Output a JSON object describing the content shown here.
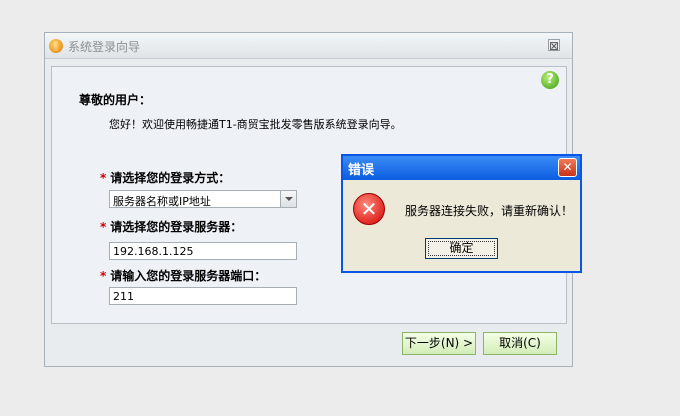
{
  "window": {
    "title": "系统登录向导",
    "close_glyph": "⊠"
  },
  "panel": {
    "greeting": "尊敬的用户：",
    "welcome": "您好！欢迎使用畅捷通T1-商贸宝批发零售版系统登录向导。",
    "help_glyph": "?"
  },
  "fields": {
    "required_mark": "*",
    "login_mode_label": "请选择您的登录方式：",
    "login_mode_value": "服务器名称或IP地址",
    "server_label": "请选择您的登录服务器：",
    "server_value": "192.168.1.125",
    "port_label": "请输入您的登录服务器端口：",
    "port_value": "211"
  },
  "buttons": {
    "next": "下一步(N) >",
    "cancel": "取消(C)"
  },
  "error_dialog": {
    "title": "错误",
    "close_glyph": "✕",
    "icon_glyph": "✕",
    "message": "服务器连接失败，请重新确认！",
    "ok": "确定"
  }
}
